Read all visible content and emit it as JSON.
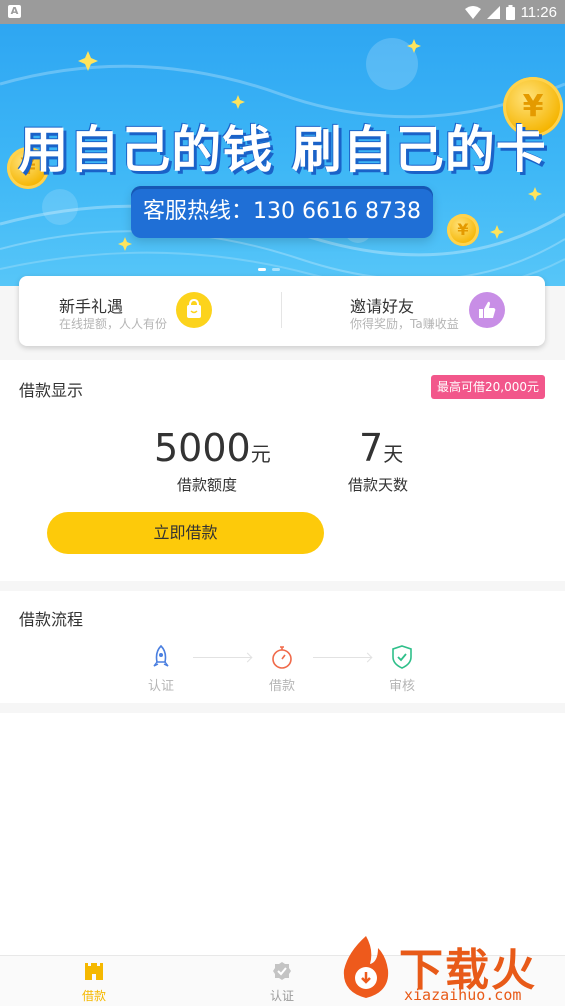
{
  "status_bar": {
    "time": "11:26",
    "app_glyph": "A",
    "icons": [
      "wifi-icon",
      "signal-icon",
      "battery-icon"
    ]
  },
  "banner": {
    "title": "用自己的钱  刷自己的卡",
    "hotline": "客服热线：130 6616 8738",
    "coin_symbol": "¥"
  },
  "quick_actions": [
    {
      "title": "新手礼遇",
      "subtitle": "在线提额，人人有份",
      "icon": "gift-bag-icon",
      "color": "#fcd31c"
    },
    {
      "title": "邀请好友",
      "subtitle": "你得奖励，Ta赚收益",
      "icon": "thumbs-up-icon",
      "color": "#c88ee6"
    }
  ],
  "loan": {
    "title": "借款显示",
    "max_badge": "最高可借20,000元",
    "amount_value": "5000",
    "amount_unit": "元",
    "amount_label": "借款额度",
    "days_value": "7",
    "days_unit": "天",
    "days_label": "借款天数",
    "button": "立即借款"
  },
  "flow": {
    "title": "借款流程",
    "steps": [
      {
        "label": "认证",
        "icon": "rocket-icon",
        "color": "#4a7fe0"
      },
      {
        "label": "借款",
        "icon": "stopwatch-icon",
        "color": "#f06a4a"
      },
      {
        "label": "审核",
        "icon": "shield-check-icon",
        "color": "#2fbf8a"
      }
    ]
  },
  "tabbar": [
    {
      "label": "借款",
      "icon": "castle-icon",
      "active": true
    },
    {
      "label": "认证",
      "icon": "badge-check-icon",
      "active": false
    }
  ],
  "watermark": {
    "text": "下载火",
    "url": "xiazaihuo.com"
  },
  "colors": {
    "accent": "#fdca0a",
    "badge": "#f2578b",
    "banner": "#3eb7f6"
  }
}
